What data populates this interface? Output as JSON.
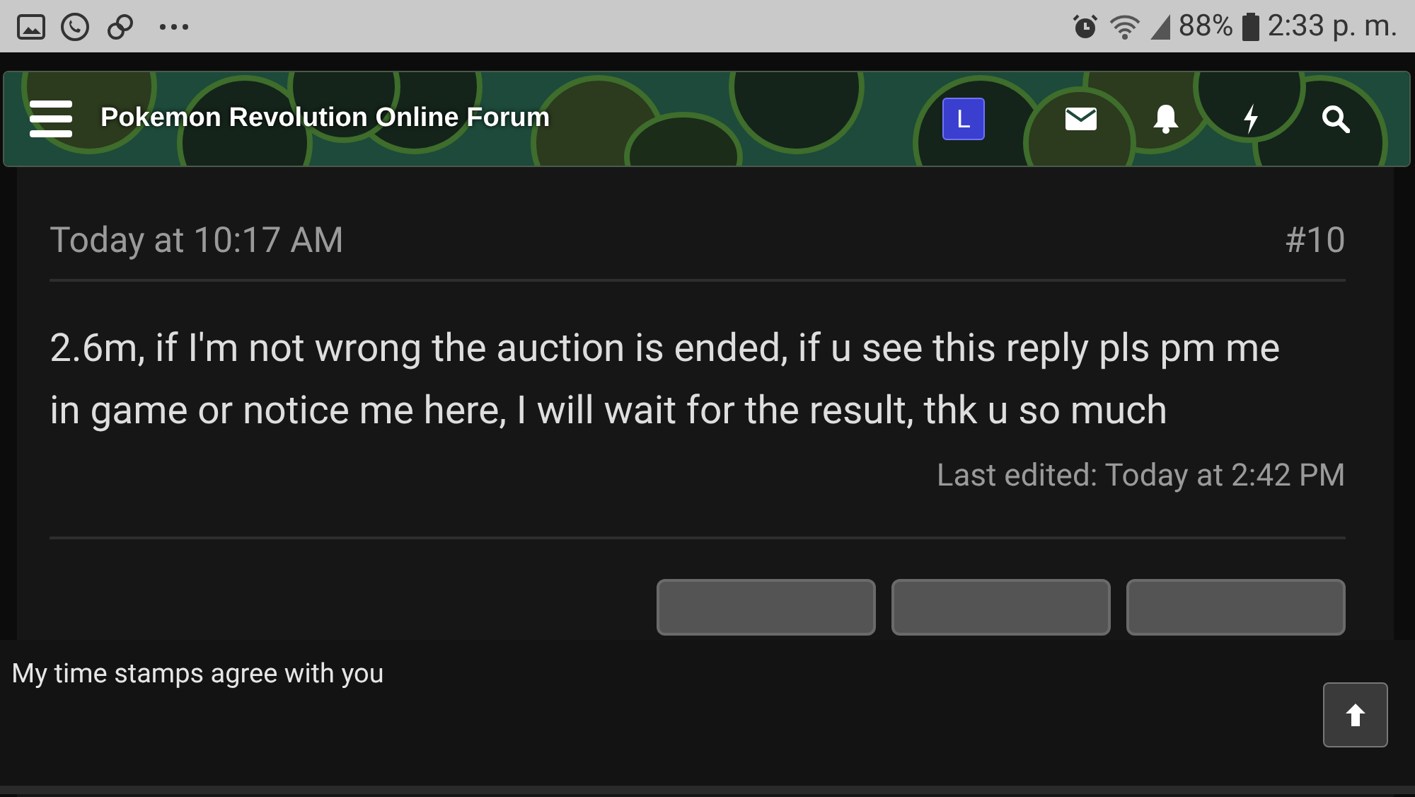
{
  "status_bar": {
    "battery": "88%",
    "time": "2:33 p. m."
  },
  "header": {
    "title": "Pokemon Revolution Online Forum",
    "avatar_letter": "L"
  },
  "post": {
    "date": "Today at 10:17 AM",
    "number": "#10",
    "message": "2.6m, if I'm not wrong the auction is ended, if u see this reply pls pm me in game or notice me here, I will wait for the result, thk u so much",
    "last_edited": "Last edited: Today at 2:42 PM"
  },
  "reply_box": {
    "text": "My time stamps agree with you"
  }
}
